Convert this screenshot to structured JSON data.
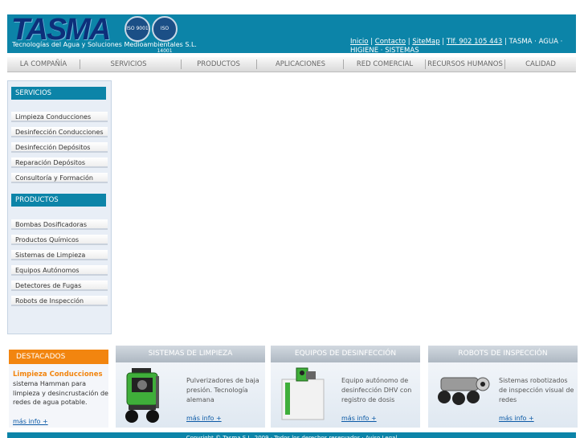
{
  "header": {
    "logo_text": "TASMA",
    "tagline": "Tecnologías del Agua y Soluciones Medioambientales S.L.",
    "iso_badges": [
      "ISO 9001",
      "ISO 14001"
    ],
    "links": [
      "Inicio",
      "Contacto",
      "SiteMap",
      "Tlf. 902 105 443"
    ],
    "extra_text": "TASMA · AGUA · HIGIENE · SISTEMAS"
  },
  "nav": {
    "items": [
      "LA COMPAÑÍA",
      "SERVICIOS",
      "PRODUCTOS",
      "APLICACIONES",
      "RED COMERCIAL",
      "RECURSOS HUMANOS",
      "CALIDAD"
    ]
  },
  "sidebar": {
    "services_title": "SERVICIOS",
    "services": [
      "Limpieza Conducciones",
      "Desinfección Conducciones",
      "Desinfección Depósitos",
      "Reparación Depósitos",
      "Consultoría y Formación"
    ],
    "products_title": "PRODUCTOS",
    "products": [
      "Bombas Dosificadoras",
      "Productos Químicos",
      "Sistemas de Limpieza",
      "Equipos Autónomos",
      "Detectores de Fugas",
      "Robots de Inspección"
    ]
  },
  "destacados": {
    "title": "DESTACADOS",
    "item_title": "Limpieza Conducciones",
    "item_desc": "sistema Hamman para limpieza y desincrustación de redes de agua potable.",
    "link": "más info +"
  },
  "panels": [
    {
      "title": "SISTEMAS DE LIMPIEZA",
      "desc": "Pulverizadores de baja presión. Tecnología alemana",
      "link": "más info +"
    },
    {
      "title": "EQUIPOS DE DESINFECCIÓN",
      "desc": "Equipo autónomo de desinfección DHV con registro de dosis",
      "link": "más info +"
    },
    {
      "title": "ROBOTS DE INSPECCIÓN",
      "desc": "Sistemas robotizados de inspección visual de redes",
      "link": "más info +"
    }
  ],
  "footer": {
    "text": "Copyright © Tasma S.L. 2009 · Todos los derechos reservados · Aviso Legal"
  }
}
